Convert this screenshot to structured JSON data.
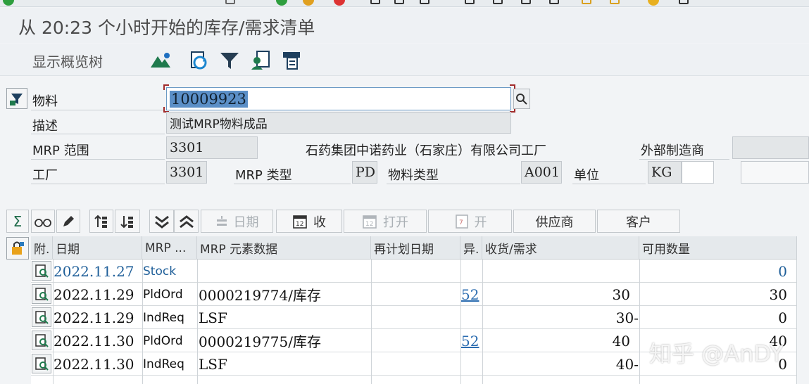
{
  "title": "从 20:23 个小时开始的库存/需求清单",
  "toolbar": {
    "overview_tree": "显示概览树",
    "icons": [
      "mountain-icon",
      "refresh-icon",
      "filter-icon",
      "person-icon",
      "print-icon"
    ]
  },
  "header": {
    "material_label": "物料",
    "material_value": "10009923",
    "description_label": "描述",
    "description_value": "测试MRP物料成品",
    "mrp_area_label": "MRP 范围",
    "mrp_area_value": "3301",
    "plant_name": "石药集团中诺药业（石家庄）有限公司工厂",
    "external_mfr_label": "外部制造商",
    "plant_label": "工厂",
    "plant_value": "3301",
    "mrp_type_label": "MRP 类型",
    "mrp_type_value": "PD",
    "material_type_label": "物料类型",
    "material_type_value": "A001",
    "unit_label": "单位",
    "unit_value": "KG"
  },
  "grid_toolbar": {
    "date_label": "日期",
    "receipt_label": "收",
    "open_label": "打开",
    "open2_label": "开",
    "supplier_label": "供应商",
    "customer_label": "客户"
  },
  "table": {
    "headers": [
      "附.",
      "日期",
      "MRP ...",
      "MRP 元素数据",
      "再计划日期",
      "异.",
      "收货/需求",
      "可用数量"
    ],
    "rows": [
      {
        "date": "2022.11.27",
        "element": "Stock",
        "data": "",
        "exception": "",
        "qty": "",
        "available": "0"
      },
      {
        "date": "2022.11.29",
        "element": "PldOrd",
        "data": "0000219774/库存",
        "exception": "52",
        "qty": "30",
        "available": "30"
      },
      {
        "date": "2022.11.29",
        "element": "IndReq",
        "data": "LSF",
        "exception": "",
        "qty": "30-",
        "available": "0"
      },
      {
        "date": "2022.11.30",
        "element": "PldOrd",
        "data": "0000219775/库存",
        "exception": "52",
        "qty": "40",
        "available": "40"
      },
      {
        "date": "2022.11.30",
        "element": "IndReq",
        "data": "LSF",
        "exception": "",
        "qty": "40-",
        "available": "0"
      }
    ]
  },
  "watermark": "知乎 @AnDY",
  "colors": {
    "link": "#1f5f99",
    "selection": "#5b8fc7",
    "bracket": "#a12b2b"
  }
}
